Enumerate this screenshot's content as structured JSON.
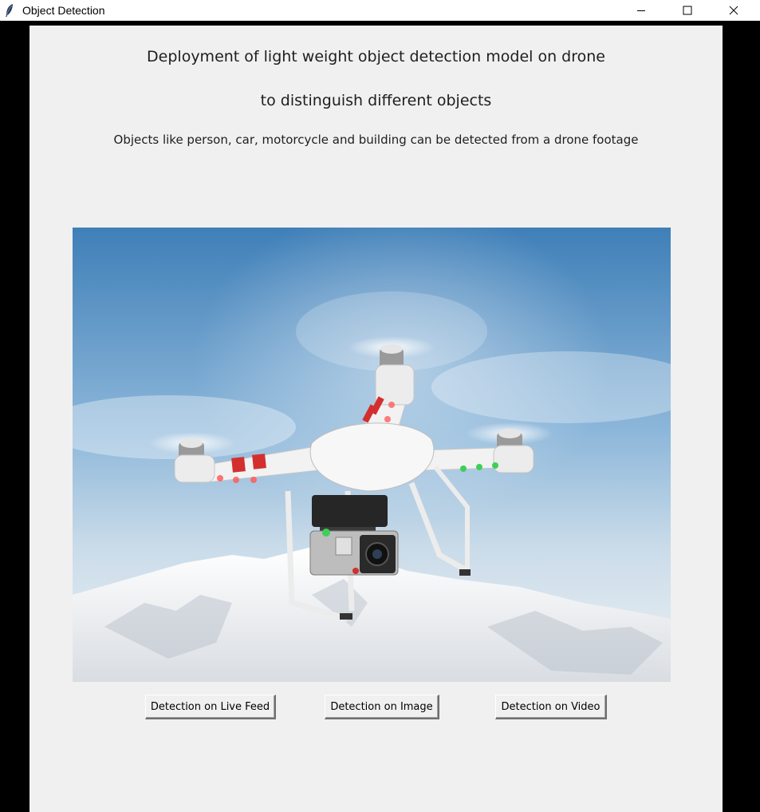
{
  "window": {
    "title": "Object Detection",
    "icon": "feather-icon",
    "controls": {
      "minimize": "minimize-icon",
      "maximize": "maximize-icon",
      "close": "close-icon"
    }
  },
  "main": {
    "heading_line1": "Deployment of light weight object detection model on drone",
    "heading_line2": "to distinguish different objects",
    "subheading": "Objects like person, car, motorcycle and building can be detected from a drone footage",
    "buttons": {
      "live_feed": "Detection on Live Feed",
      "image": "Detection on Image",
      "video": "Detection on Video"
    }
  },
  "colors": {
    "client_background": "#f0f0f0",
    "window_background": "#000000",
    "sky_top": "#3f7fb8",
    "drone_red": "#d32f2f",
    "drone_green": "#3ecf57"
  }
}
